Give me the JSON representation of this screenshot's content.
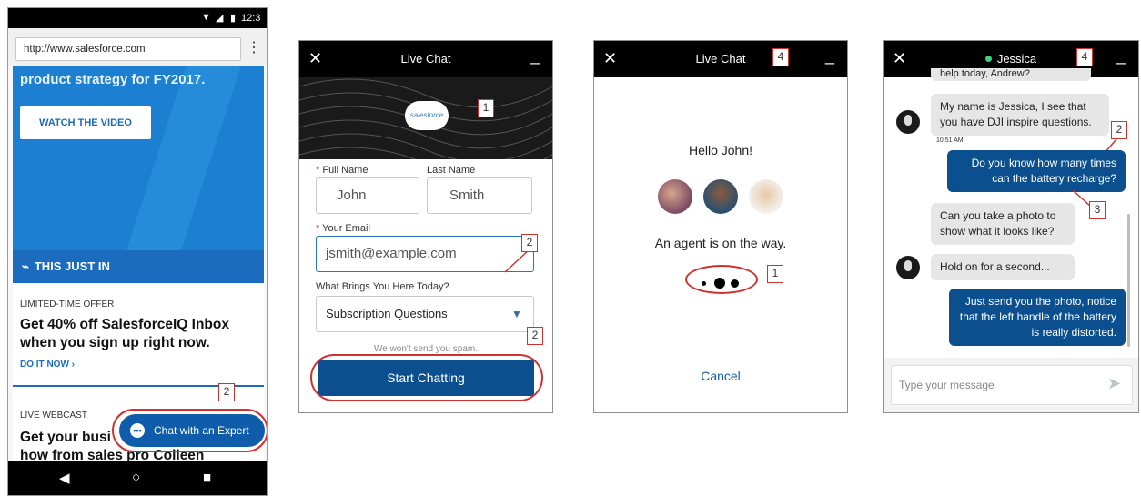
{
  "phone": {
    "status_time": "12:3",
    "url": "http://www.salesforce.com",
    "hero_title": "product strategy for FY2017.",
    "watch_button": "WATCH THE VIDEO",
    "just_in": "THIS JUST IN",
    "offer_eyebrow": "LIMITED-TIME OFFER",
    "offer_headline": "Get 40% off SalesforceIQ Inbox when you sign up right now.",
    "offer_link": "DO IT NOW ›",
    "webcast_eyebrow": "LIVE WEBCAST",
    "webcast_headline_1": "Get your busi",
    "webcast_headline_2": "how from sales pro Colleen",
    "chat_button": "Chat with an Expert",
    "callout": "2"
  },
  "form": {
    "title": "Live Chat",
    "logo": "salesforce",
    "full_name_label": "Full Name",
    "last_name_label": "Last Name",
    "first_name_value": "John",
    "last_name_value": "Smith",
    "email_label": "Your Email",
    "email_value": "jsmith@example.com",
    "reason_label": "What Brings You Here Today?",
    "reason_value": "Subscription Questions",
    "spam_note": "We won't send you spam.",
    "start_button": "Start Chatting",
    "callout_logo": "1",
    "callout_email": "2",
    "callout_button": "2"
  },
  "waiting": {
    "title": "Live Chat",
    "greeting": "Hello John!",
    "status": "An agent is on the way.",
    "cancel": "Cancel",
    "callout_header": "4",
    "callout_dots": "1"
  },
  "conversation": {
    "agent_name": "Jessica",
    "cut_top": "help today, Andrew?",
    "msg1": "My name is Jessica, I see that you have DJI inspire questions.",
    "time1": "10:51 AM",
    "msg2": "Do you know how many times can the battery recharge?",
    "msg3": "Can you take a photo to show what it looks like?",
    "msg4": "Hold on for a second...",
    "msg5": "Just send you the photo, notice that the left handle of the battery is really distorted.",
    "composer_placeholder": "Type your message",
    "callout_header": "4",
    "callout_2": "2",
    "callout_3": "3"
  },
  "colors": {
    "brand_blue": "#0b4f8f",
    "callout_red": "#d0312d",
    "online_green": "#4bca81"
  }
}
